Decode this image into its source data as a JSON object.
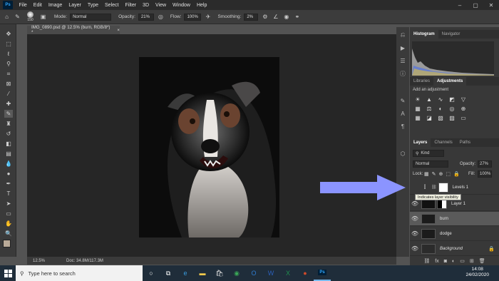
{
  "menubar": {
    "logo": "Ps",
    "items": [
      "File",
      "Edit",
      "Image",
      "Layer",
      "Type",
      "Select",
      "Filter",
      "3D",
      "View",
      "Window",
      "Help"
    ]
  },
  "options": {
    "brush_size": "150",
    "mode_label": "Mode:",
    "mode_value": "Normal",
    "opacity_label": "Opacity:",
    "opacity_value": "21%",
    "flow_label": "Flow:",
    "flow_value": "100%",
    "smoothing_label": "Smoothing:",
    "smoothing_value": "2%"
  },
  "document": {
    "tab_label": "IMG_0890.psd @ 12.5% (burn, RGB/8*) *",
    "close": "×"
  },
  "status": {
    "zoom": "12.5%",
    "doc_size": "Doc: 34.8M/117.3M"
  },
  "panels": {
    "top_tabs": [
      "Histogram",
      "Navigator"
    ],
    "mid_tabs": [
      "Libraries",
      "Adjustments"
    ],
    "adjust_hint": "Add an adjustment",
    "layers_tabs": [
      "Layers",
      "Channels",
      "Paths"
    ],
    "kind_label": "Kind",
    "blend_mode": "Normal",
    "opacity_label": "Opacity:",
    "opacity_value": "27%",
    "lock_label": "Lock:",
    "fill_label": "Fill:",
    "fill_value": "100%"
  },
  "layers": [
    {
      "name": "Levels 1"
    },
    {
      "name": "Layer 1"
    },
    {
      "name": "burn"
    },
    {
      "name": "dodge"
    },
    {
      "name": "Background"
    }
  ],
  "tooltip": "Indicates layer visibility",
  "taskbar": {
    "search_placeholder": "Type here to search",
    "time": "14:08",
    "date": "24/02/2020"
  },
  "colors": {
    "accent_arrow": "#8b94ff",
    "photoshop_blue": "#31a8ff",
    "taskbar": "#1f2d3a"
  }
}
